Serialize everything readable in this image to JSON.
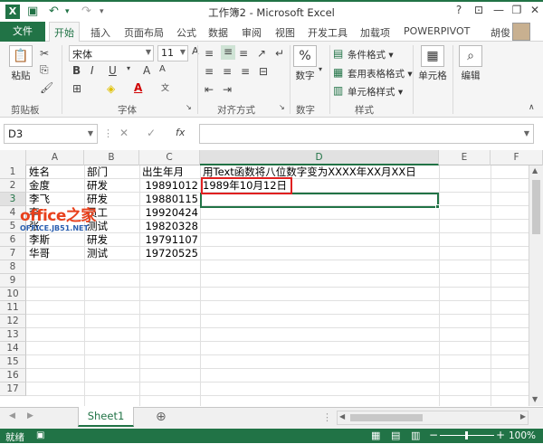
{
  "window": {
    "title": "工作簿2 - Microsoft Excel",
    "help": "?"
  },
  "menu": {
    "file": "文件",
    "tabs": [
      "开始",
      "插入",
      "页面布局",
      "公式",
      "数据",
      "审阅",
      "视图",
      "开发工具",
      "加载项",
      "POWERPIVOT"
    ],
    "user": "胡俊"
  },
  "ribbon": {
    "paste": "粘贴",
    "font_name": "宋体",
    "font_size": "11",
    "groups": {
      "clipboard": "剪贴板",
      "font": "字体",
      "align": "对齐方式",
      "number": "数字",
      "styles": "样式",
      "cells": "单元格",
      "edit": "编辑"
    },
    "number_btn": "数字",
    "percent": "%",
    "cond_format": "条件格式",
    "table_format": "套用表格格式",
    "cell_style": "单元格样式",
    "cells_btn": "单元格",
    "edit_btn": "编辑"
  },
  "formula_bar": {
    "name_box": "D3",
    "fx": "fx",
    "formula": ""
  },
  "columns": [
    "A",
    "B",
    "C",
    "D",
    "E",
    "F"
  ],
  "rows": [
    "1",
    "2",
    "3",
    "4",
    "5",
    "6",
    "7",
    "8",
    "9",
    "10",
    "11",
    "12",
    "13",
    "14",
    "15",
    "16",
    "17"
  ],
  "cells": {
    "A1": "姓名",
    "B1": "部门",
    "C1": "出生年月",
    "D1": "用Text函数将八位数字变为XXXX年XX月XX日",
    "A2": "金度",
    "B2": "研发",
    "C2": "19891012",
    "D2": "1989年10月12日",
    "A3": "李飞",
    "B3": "研发",
    "C3": "19880115",
    "A4": "李",
    "B4": "员工",
    "C4": "19920424",
    "A5": "张",
    "B5": "测试",
    "C5": "19820328",
    "A6": "李斯",
    "B6": "研发",
    "C6": "19791107",
    "A7": "华哥",
    "B7": "测试",
    "C7": "19720525"
  },
  "watermark": {
    "text1": "office之家",
    "text2": "OFFICE.JB51.NET"
  },
  "sheet": {
    "name": "Sheet1",
    "add": "⊕"
  },
  "status": {
    "ready": "就绪",
    "zoom": "100%",
    "minus": "−",
    "plus": "+"
  }
}
